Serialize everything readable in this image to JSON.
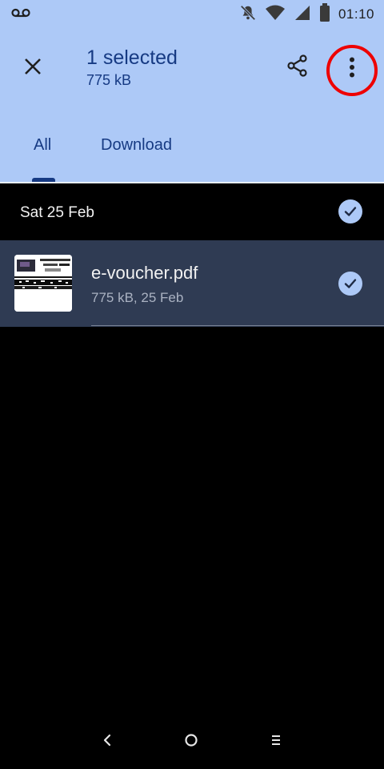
{
  "status_bar": {
    "time": "01:10",
    "icons": [
      "voicemail-icon",
      "notifications-off-icon",
      "wifi-icon",
      "signal-icon",
      "battery-icon"
    ]
  },
  "app_bar": {
    "title": "1 selected",
    "subtitle": "775 kB",
    "close_icon": "close-icon",
    "share_icon": "share-icon",
    "more_icon": "more-vert-icon",
    "highlight_color": "#ee0000"
  },
  "tabs": [
    {
      "label": "All",
      "selected": true
    },
    {
      "label": "Download",
      "selected": false
    }
  ],
  "content": {
    "groups": [
      {
        "date": "Sat 25 Feb",
        "selected": true,
        "files": [
          {
            "name": "e-voucher.pdf",
            "meta": "775 kB, 25 Feb",
            "selected": true
          }
        ]
      }
    ]
  },
  "nav_bar": {
    "icons": [
      "back-icon",
      "home-icon",
      "recents-icon"
    ]
  },
  "colors": {
    "header_bg": "#adc9f7",
    "header_text": "#163a83",
    "selected_row_bg": "#2f3b53",
    "check_bg": "#adc9f7"
  }
}
